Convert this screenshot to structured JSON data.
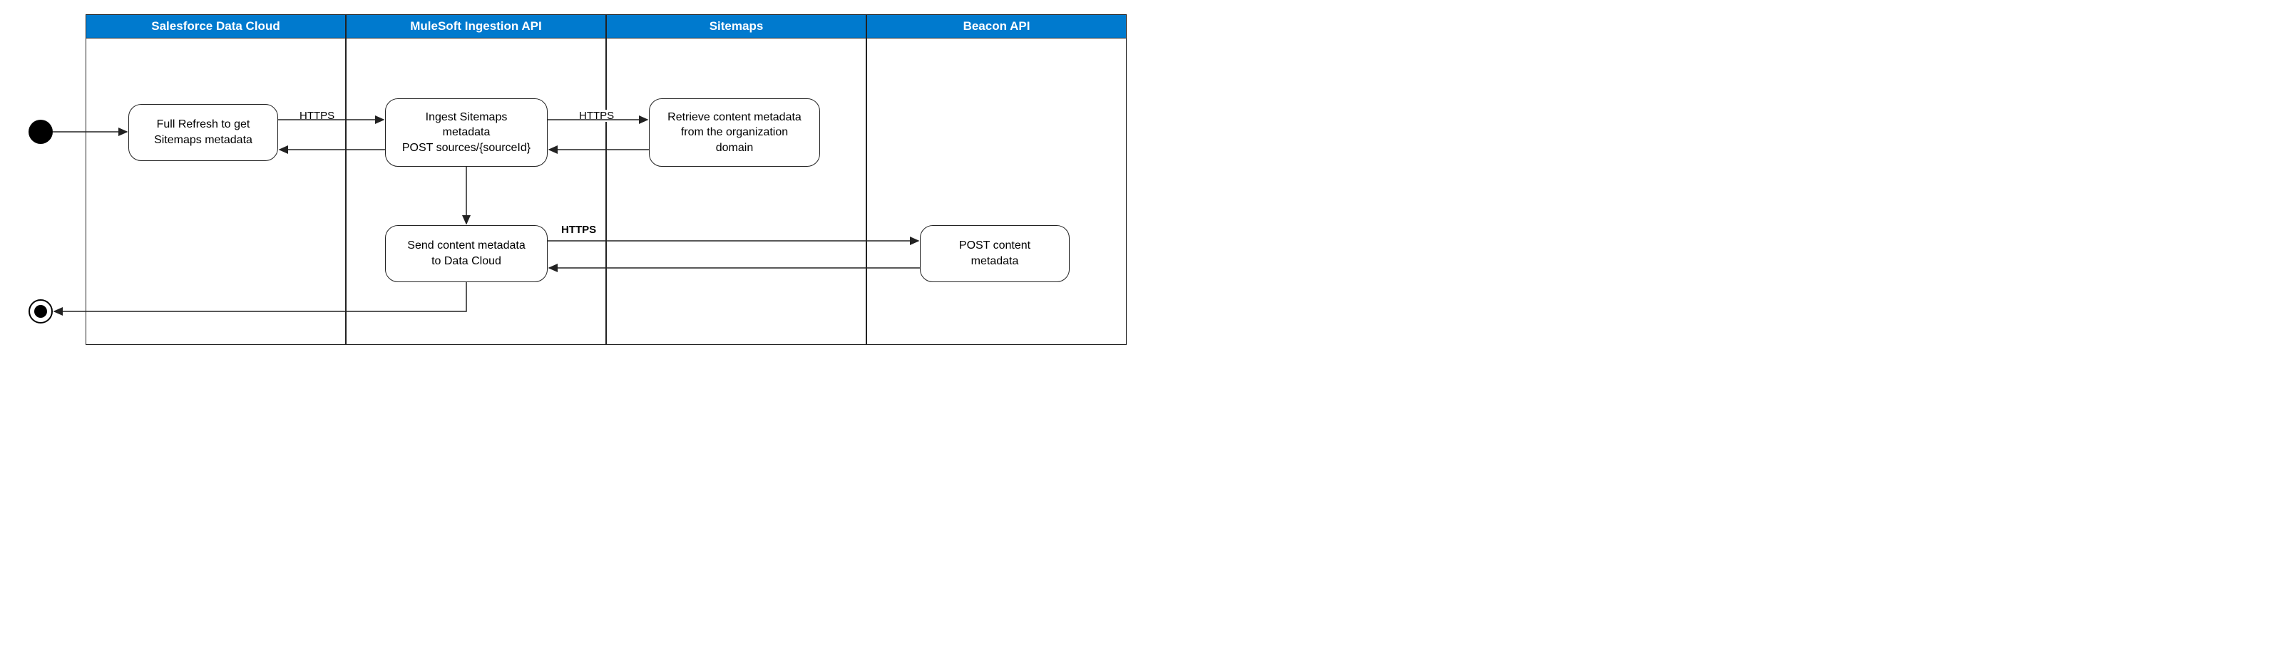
{
  "lanes": {
    "l1": "Salesforce Data Cloud",
    "l2": "MuleSoft  Ingestion API",
    "l3": "Sitemaps",
    "l4": "Beacon API"
  },
  "nodes": {
    "n1_line1": "Full Refresh to get",
    "n1_line2": "Sitemaps metadata",
    "n2_line1": "Ingest Sitemaps",
    "n2_line2": "metadata",
    "n2_line3": "POST sources/{sourceId}",
    "n3_line1": "Retrieve content metadata",
    "n3_line2": "from the organization",
    "n3_line3": "domain",
    "n4_line1": "Send content metadata",
    "n4_line2": "to Data Cloud",
    "n5_line1": "POST content",
    "n5_line2": "metadata"
  },
  "edges": {
    "e1": "HTTPS",
    "e2": "HTTPS",
    "e3": "HTTPS"
  }
}
